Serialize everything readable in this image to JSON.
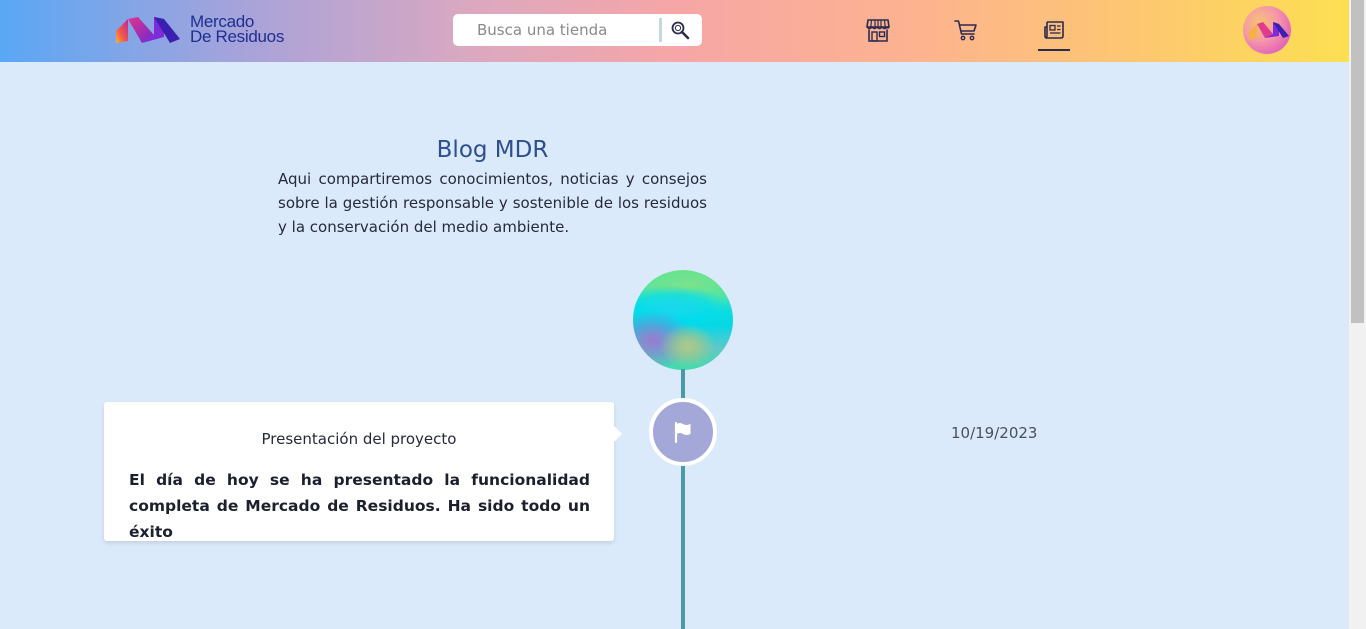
{
  "header": {
    "logo_line1": "Mercado",
    "logo_line2": "De Residuos",
    "search_placeholder": "Busca una tienda",
    "nav": [
      {
        "name": "stores",
        "icon": "store-icon"
      },
      {
        "name": "cart",
        "icon": "cart-icon"
      },
      {
        "name": "blog",
        "icon": "newspaper-icon",
        "active": true
      }
    ],
    "avatar_icon": "logo-avatar"
  },
  "blog": {
    "title": "Blog MDR",
    "description": "Aqui compartiremos conocimientos, noticias y consejos sobre la gestión responsable y sostenible de los residuos y la conservación del medio ambiente."
  },
  "timeline": [
    {
      "title": "Presentación del proyecto",
      "body": "El día de hoy se ha presentado la funcionalidad completa de Mercado de Residuos. Ha sido todo un éxito",
      "date": "10/19/2023",
      "icon": "flag-icon"
    }
  ],
  "colors": {
    "timeline_line": "#4a9ba4",
    "node": "#a4a8d8",
    "page_bg": "#dbeafb",
    "title": "#2d4e8f"
  }
}
